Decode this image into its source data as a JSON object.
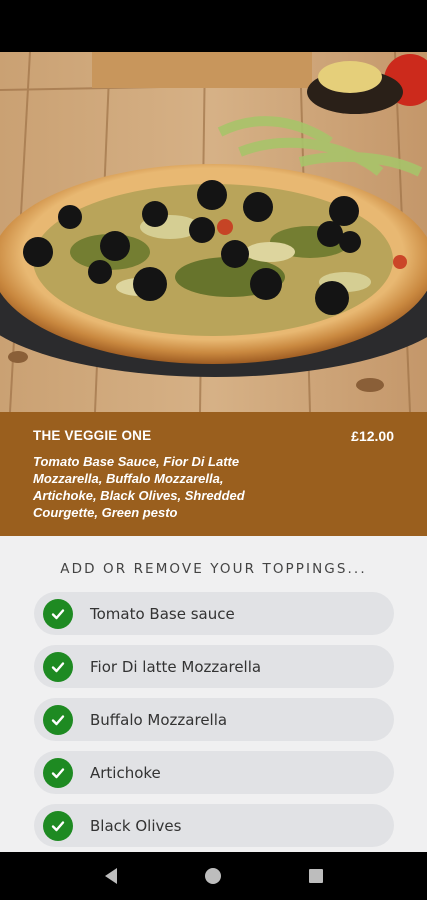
{
  "product": {
    "name": "THE VEGGIE ONE",
    "price": "£12.00",
    "description": "Tomato Base Sauce, Fior Di Latte Mozzarella, Buffalo Mozzarella, Artichoke, Black Olives, Shredded Courgette, Green pesto"
  },
  "toppings": {
    "heading": "ADD OR REMOVE YOUR TOPPINGS...",
    "items": [
      {
        "label": "Tomato Base sauce",
        "selected": true
      },
      {
        "label": "Fior Di latte Mozzarella",
        "selected": true
      },
      {
        "label": "Buffalo Mozzarella",
        "selected": true
      },
      {
        "label": "Artichoke",
        "selected": true
      },
      {
        "label": "Black Olives",
        "selected": true
      }
    ]
  },
  "colors": {
    "info_bg": "#9a5f1e",
    "check": "#1e8a22",
    "list_bg": "#f0f0f1"
  },
  "icons": {
    "check": "check-icon",
    "back": "back-triangle-icon",
    "home": "home-circle-icon",
    "recents": "recents-square-icon"
  }
}
